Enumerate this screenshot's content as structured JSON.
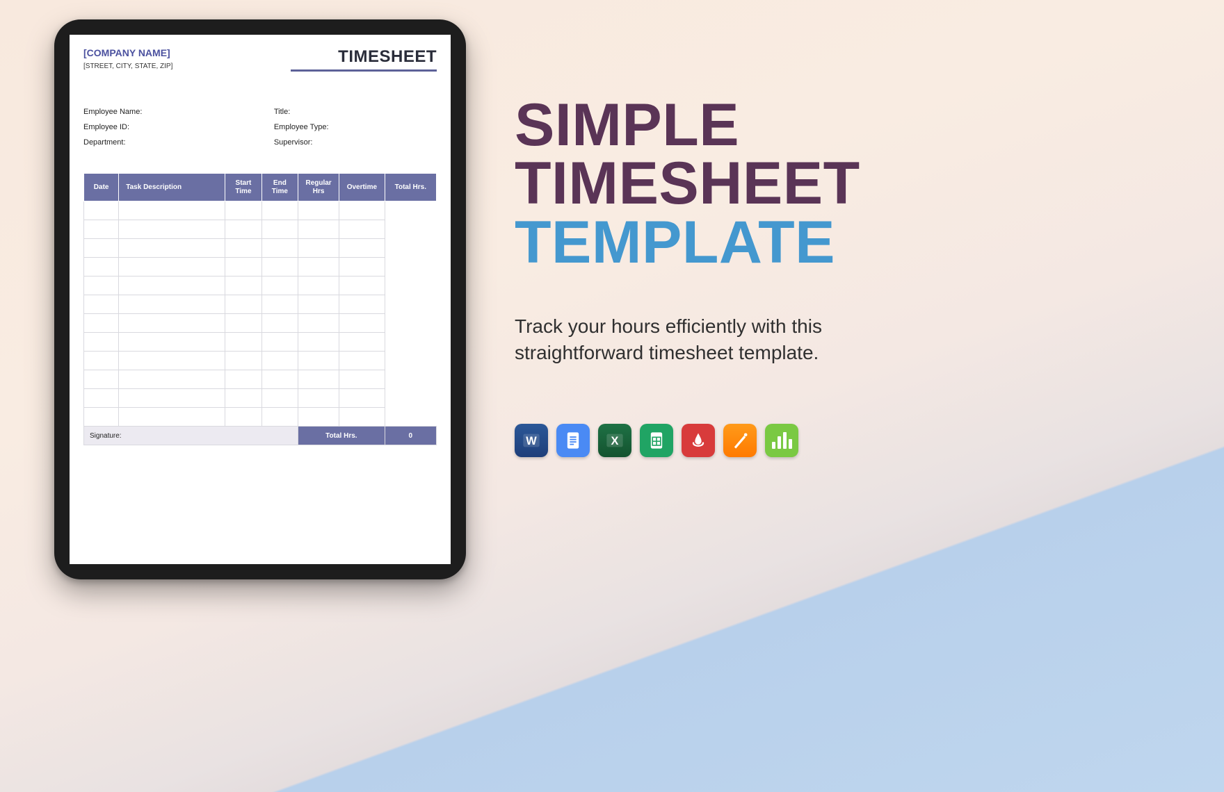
{
  "doc": {
    "company": "[COMPANY NAME]",
    "address": "[STREET, CITY, STATE, ZIP]",
    "title": "TIMESHEET",
    "fields": {
      "employee_name": "Employee Name:",
      "employee_id": "Employee ID:",
      "department": "Department:",
      "job_title": "Title:",
      "employee_type": "Employee Type:",
      "supervisor": "Supervisor:"
    },
    "columns": {
      "date": "Date",
      "desc": "Task Description",
      "start": "Start Time",
      "end": "End Time",
      "reg": "Regular Hrs",
      "ot": "Overtime",
      "total": "Total Hrs."
    },
    "row_total_value": "0",
    "row_count": 12,
    "footer": {
      "signature": "Signature:",
      "total_label": "Total Hrs.",
      "total_value": "0"
    }
  },
  "promo": {
    "line1": "SIMPLE",
    "line2": "TIMESHEET",
    "line3": "TEMPLATE",
    "tagline": "Track your hours efficiently with this straightforward timesheet template."
  },
  "formats": {
    "word": "Microsoft Word",
    "gdocs": "Google Docs",
    "excel": "Microsoft Excel",
    "gsheets": "Google Sheets",
    "pdf": "PDF",
    "pages": "Apple Pages",
    "numbers": "Apple Numbers"
  },
  "colors": {
    "table_header": "#6a6fa3",
    "accent_purple": "#5a3456",
    "accent_blue": "#4498cf"
  }
}
